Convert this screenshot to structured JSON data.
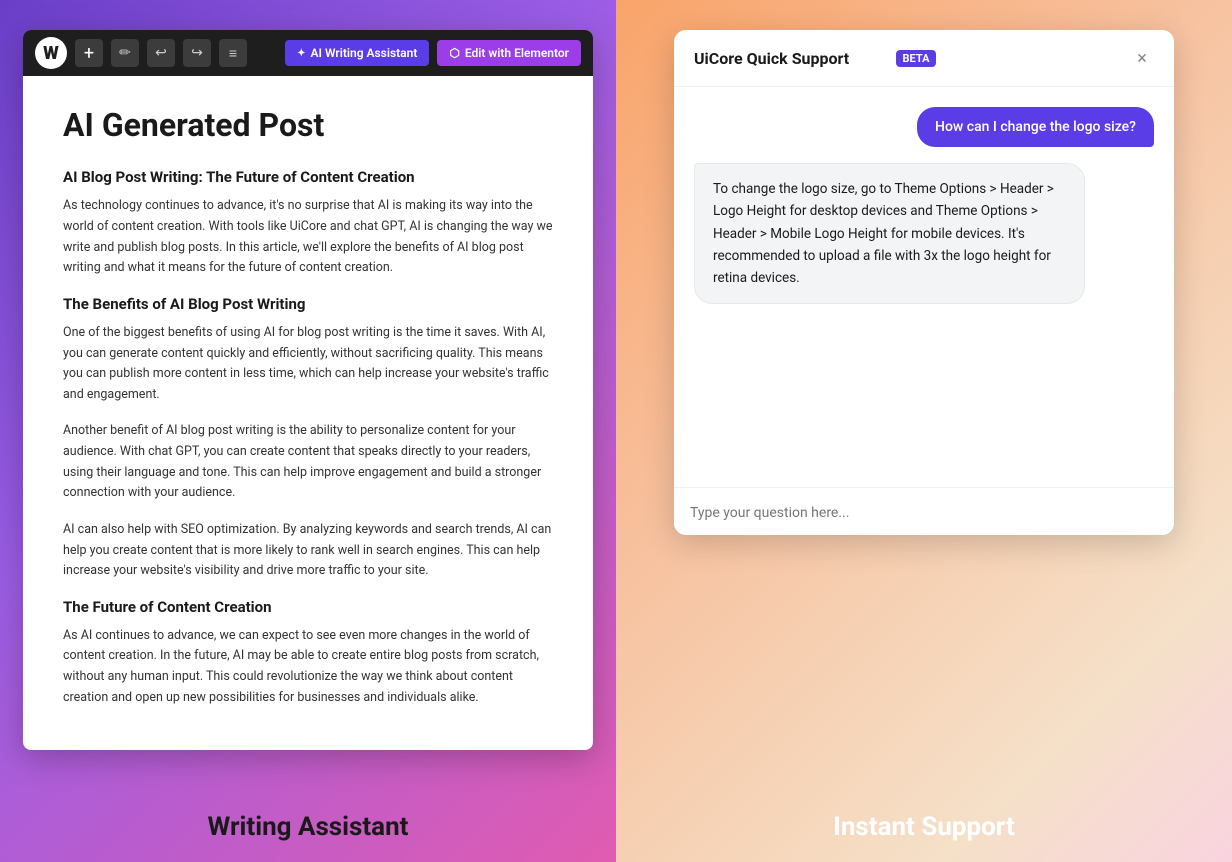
{
  "left": {
    "toolbar": {
      "wp_logo": "W",
      "plus_label": "+",
      "pen_label": "✏",
      "undo_label": "↩",
      "redo_label": "↪",
      "menu_label": "≡",
      "ai_writing_btn": "AI Writing Assistant",
      "elementor_btn": "Edit with Elementor"
    },
    "post": {
      "title": "AI Generated Post",
      "section1_heading": "AI Blog Post Writing: The Future of Content Creation",
      "section1_body": "As technology continues to advance, it's no surprise that AI is making its way into the world of content creation. With tools like UiCore and chat GPT, AI is changing the way we write and publish blog posts. In this article, we'll explore the benefits of AI blog post writing and what it means for the future of content creation.",
      "section2_heading": "The Benefits of AI Blog Post Writing",
      "section2_body1": "One of the biggest benefits of using AI for blog post writing is the time it saves. With AI, you can generate content quickly and efficiently, without sacrificing quality. This means you can publish more content in less time, which can help increase your website's traffic and engagement.",
      "section2_body2": "Another benefit of AI blog post writing is the ability to personalize content for your audience. With chat GPT, you can create content that speaks directly to your readers, using their language and tone. This can help improve engagement and build a stronger connection with your audience.",
      "section2_body3": "AI can also help with SEO optimization. By analyzing keywords and search trends, AI can help you create content that is more likely to rank well in search engines. This can help increase your website's visibility and drive more traffic to your site.",
      "section3_heading": "The Future of Content Creation",
      "section3_body": "As AI continues to advance, we can expect to see even more changes in the world of content creation. In the future, AI may be able to create entire blog posts from scratch, without any human input. This could revolutionize the way we think about content creation and open up new possibilities for businesses and individuals alike."
    },
    "bottom_label": "Writing Assistant"
  },
  "right": {
    "chat": {
      "title": "UiCore Quick Support",
      "beta_badge": "BETA",
      "close_label": "×",
      "user_message": "How can I change the logo size?",
      "bot_message": "To change the logo size, go to Theme Options > Header > Logo Height for desktop devices and Theme Options > Header > Mobile Logo Height for mobile devices. It's recommended to upload a file with 3x the logo height for retina devices.",
      "input_placeholder": "Type your question here..."
    },
    "bottom_label": "Instant Support"
  }
}
